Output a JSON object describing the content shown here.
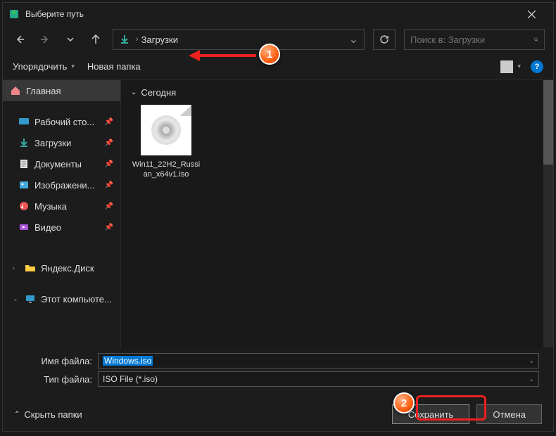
{
  "title": "Выберите путь",
  "address": {
    "location": "Загрузки"
  },
  "search": {
    "placeholder": "Поиск в: Загрузки"
  },
  "toolbar": {
    "organize": "Упорядочить",
    "new_folder": "Новая папка"
  },
  "sidebar": {
    "home": "Главная",
    "desktop": "Рабочий сто...",
    "downloads": "Загрузки",
    "documents": "Документы",
    "pictures": "Изображени...",
    "music": "Музыка",
    "videos": "Видео",
    "yadisk": "Яндекс.Диск",
    "thispc": "Этот компьюте..."
  },
  "content": {
    "group": "Сегодня",
    "file": "Win11_22H2_Russian_x64v1.iso"
  },
  "form": {
    "filename_label": "Имя файла:",
    "filename_value": "Windows.iso",
    "filetype_label": "Тип файла:",
    "filetype_value": "ISO File (*.iso)"
  },
  "footer": {
    "hide": "Скрыть папки",
    "save": "Сохранить",
    "cancel": "Отмена"
  },
  "annotations": {
    "b1": "1",
    "b2": "2"
  }
}
